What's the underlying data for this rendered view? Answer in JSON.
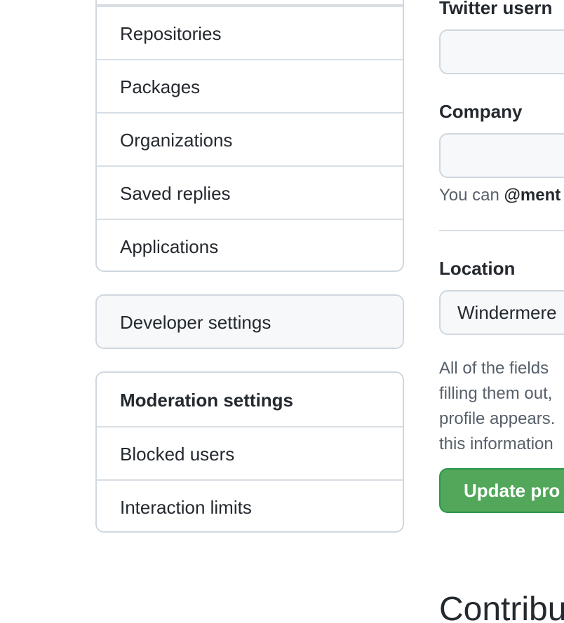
{
  "sidebar": {
    "main_items": [
      {
        "label": "Repositories"
      },
      {
        "label": "Packages"
      },
      {
        "label": "Organizations"
      },
      {
        "label": "Saved replies"
      },
      {
        "label": "Applications"
      }
    ],
    "developer_settings_label": "Developer settings",
    "moderation": {
      "heading": "Moderation settings",
      "items": [
        {
          "label": "Blocked users"
        },
        {
          "label": "Interaction limits"
        }
      ]
    }
  },
  "profile_form": {
    "twitter_label": "Twitter usern",
    "twitter_value": "",
    "company_label": "Company",
    "company_value": "",
    "company_help_prefix": "You can ",
    "company_help_mention": "@ment",
    "location_label": "Location",
    "location_value": "Windermere",
    "note_lines": [
      "All of the fields",
      "filling them out,",
      "profile appears.",
      "this information"
    ],
    "update_button_label": "Update pro",
    "contributions_heading": "Contribu"
  },
  "colors": {
    "border": "#d0d7de",
    "divider": "#d8dee4",
    "muted_text": "#57606a",
    "text": "#24292f",
    "button_green": "#52a75a",
    "subtle_bg": "#f6f8fa"
  }
}
